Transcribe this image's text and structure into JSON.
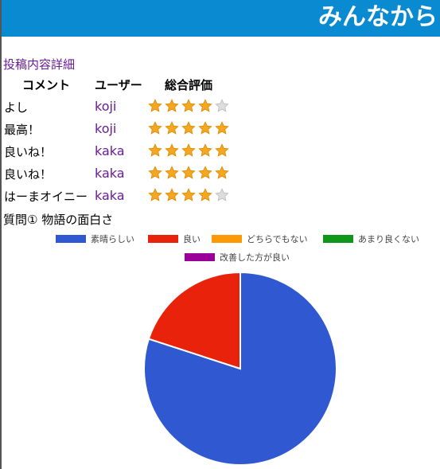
{
  "header": {
    "title": "みんなから"
  },
  "post_detail_link": "投稿内容詳細",
  "table": {
    "headers": [
      "コメント",
      "ユーザー",
      "総合評価"
    ],
    "rows": [
      {
        "comment": "よし",
        "user": "koji",
        "rating": 4,
        "max": 5
      },
      {
        "comment": "最高！",
        "user": "koji",
        "rating": 5,
        "max": 5
      },
      {
        "comment": "良いね！",
        "user": "kaka",
        "rating": 5,
        "max": 5
      },
      {
        "comment": "良いね！",
        "user": "kaka",
        "rating": 5,
        "max": 5
      },
      {
        "comment": "はーまオイニー",
        "user": "kaka",
        "rating": 4,
        "max": 5
      }
    ]
  },
  "question": "質問① 物語の面白さ",
  "colors": {
    "header_bg": "#0a8ad0",
    "link": "#6a1b9a",
    "star_filled": "#f5a623",
    "star_empty": "#dddddd"
  },
  "chart_data": {
    "type": "pie",
    "title": "",
    "legend_position": "top",
    "series": [
      {
        "name": "素晴らしい",
        "value": 4,
        "color": "#3059d1"
      },
      {
        "name": "良い",
        "value": 1,
        "color": "#e8220b"
      },
      {
        "name": "どちらでもない",
        "value": 0,
        "color": "#fb9a06"
      },
      {
        "name": "あまり良くない",
        "value": 0,
        "color": "#109618"
      },
      {
        "name": "改善した方が良い",
        "value": 0,
        "color": "#990099"
      }
    ]
  }
}
